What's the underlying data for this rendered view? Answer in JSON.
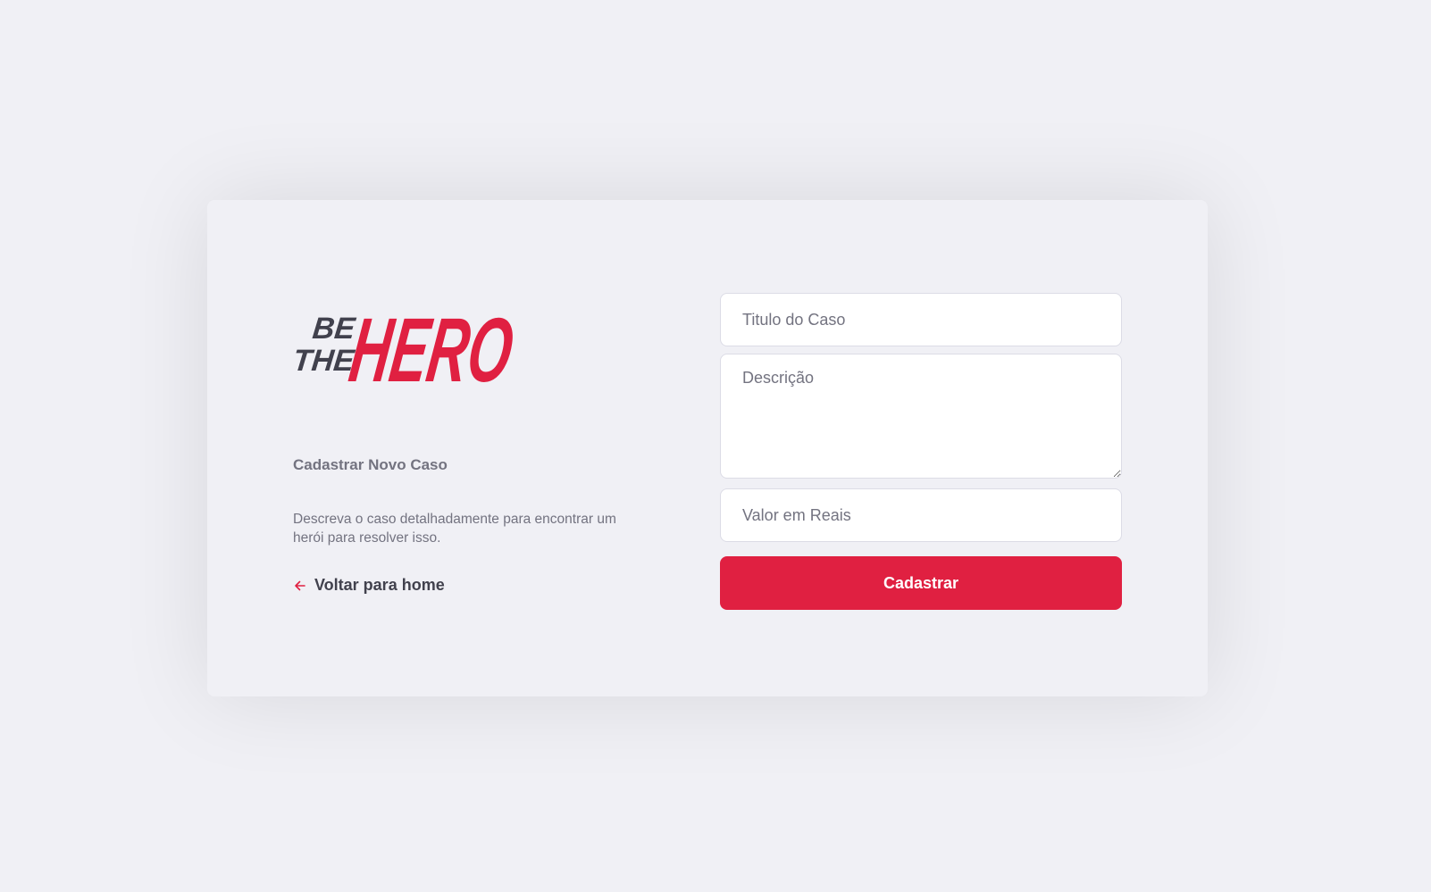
{
  "brand": {
    "logo_line1": "BE",
    "logo_line2": "THE",
    "logo_main": "HERO",
    "accent_color": "#E02041",
    "dark_color": "#41414D"
  },
  "intro": {
    "title": "Cadastrar Novo Caso",
    "description": "Descreva o caso detalhadamente para encontrar um herói para resolver isso.",
    "back_link": "Voltar para home",
    "back_icon": "arrow-left-icon"
  },
  "form": {
    "title_placeholder": "Titulo do Caso",
    "description_placeholder": "Descrição",
    "value_placeholder": "Valor em Reais",
    "submit_label": "Cadastrar"
  }
}
